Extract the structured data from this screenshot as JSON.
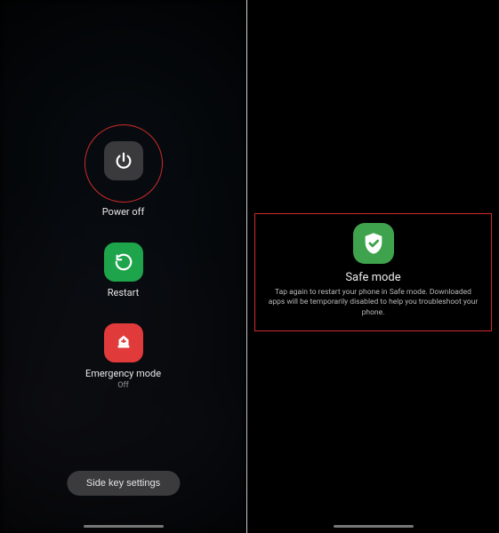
{
  "left": {
    "power_off": {
      "label": "Power off"
    },
    "restart": {
      "label": "Restart"
    },
    "emergency": {
      "label": "Emergency mode",
      "sublabel": "Off"
    },
    "side_key": "Side key settings"
  },
  "right": {
    "safemode": {
      "title": "Safe mode",
      "desc": "Tap again to restart your phone in Safe mode. Downloaded apps will be temporarily disabled to help you troubleshoot your phone."
    }
  }
}
